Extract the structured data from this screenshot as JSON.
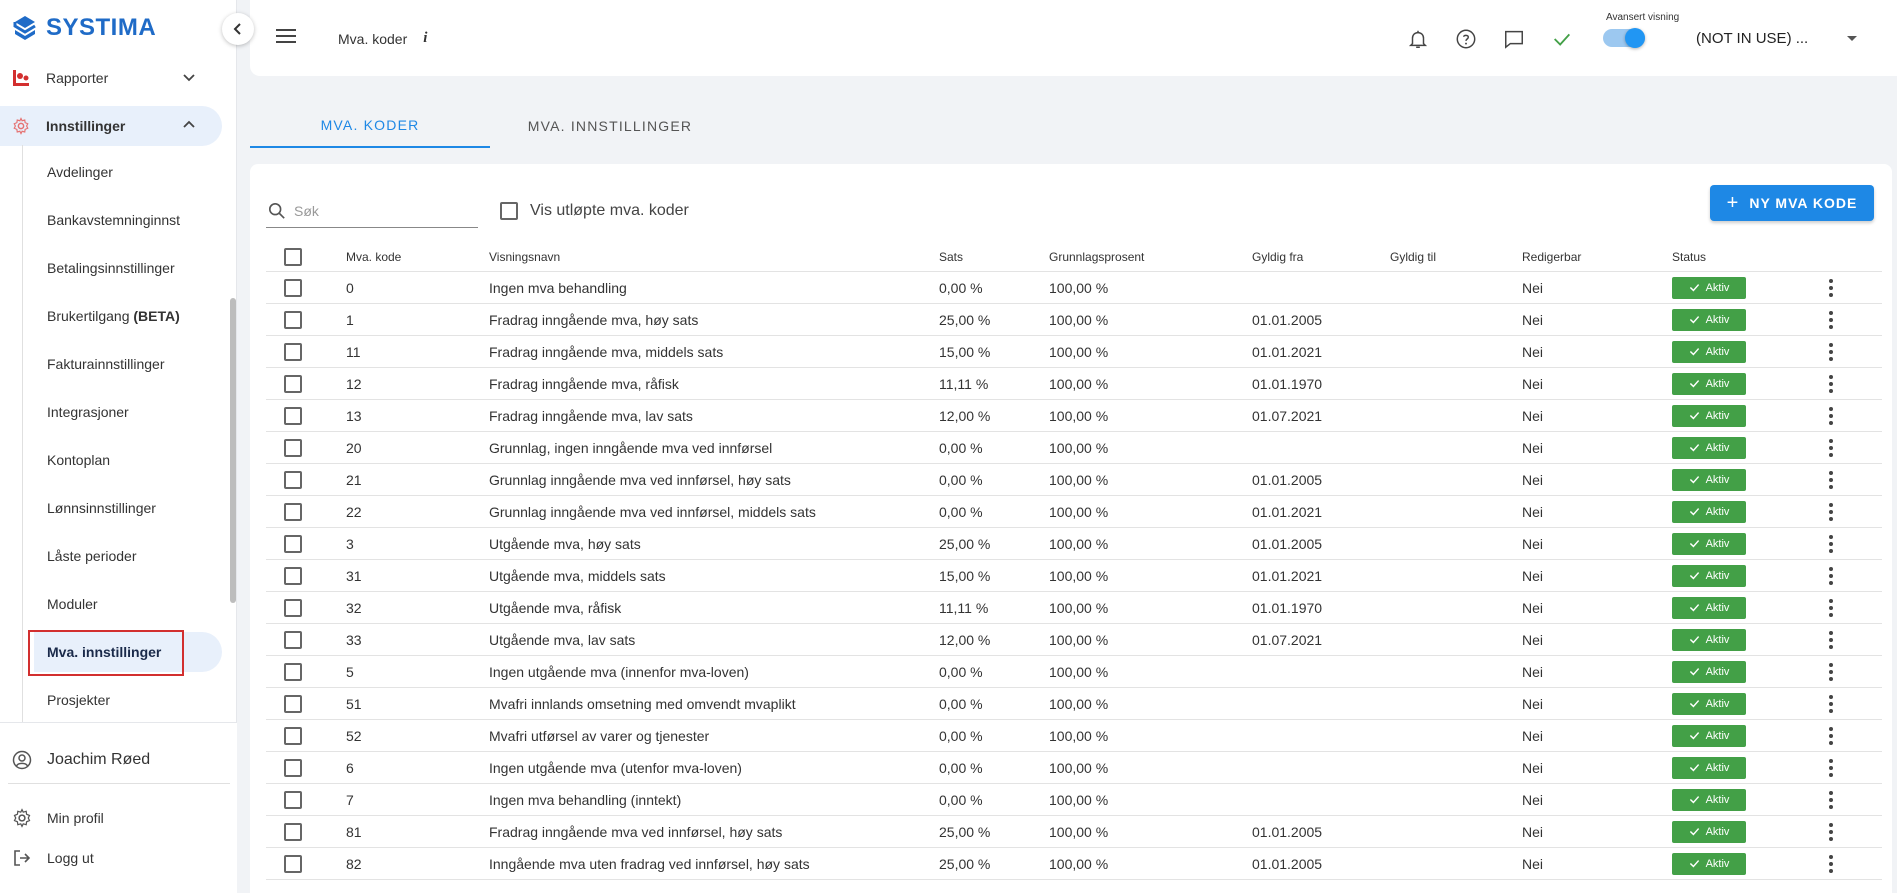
{
  "app": {
    "logo_text": "SYSTIMA",
    "brand_color": "#1f6bc7",
    "accent_color": "#1e88e5",
    "status_color": "#43a047"
  },
  "sidebar": {
    "sections": [
      {
        "label": "Rapporter",
        "icon": "reports-icon",
        "expanded": false
      },
      {
        "label": "Innstillinger",
        "icon": "gear-icon",
        "expanded": true
      }
    ],
    "sub_items": [
      {
        "label": "Avdelinger"
      },
      {
        "label": "Bankavstemninginnst"
      },
      {
        "label": "Betalingsinnstillinger"
      },
      {
        "label": "Brukertilgang",
        "suffix": "(BETA)"
      },
      {
        "label": "Fakturainnstillinger"
      },
      {
        "label": "Integrasjoner"
      },
      {
        "label": "Kontoplan"
      },
      {
        "label": "Lønnsinnstillinger"
      },
      {
        "label": "Låste perioder"
      },
      {
        "label": "Moduler"
      },
      {
        "label": "Mva. innstillinger",
        "selected": true
      },
      {
        "label": "Prosjekter"
      }
    ],
    "user_name": "Joachim Røed",
    "profile_label": "Min profil",
    "logout_label": "Logg ut"
  },
  "header": {
    "title": "Mva. koder",
    "info_glyph": "i",
    "advanced_label": "Avansert visning",
    "advanced_on": true,
    "company": "(NOT IN USE) ..."
  },
  "tabs": [
    {
      "label": "MVA. KODER",
      "active": true
    },
    {
      "label": "MVA. INNSTILLINGER",
      "active": false
    }
  ],
  "toolbar": {
    "search_placeholder": "Søk",
    "show_expired_label": "Vis utløpte mva. koder",
    "new_button_label": "NY MVA KODE",
    "new_button_glyph": "+"
  },
  "table": {
    "headers": {
      "code": "Mva. kode",
      "name": "Visningsnavn",
      "rate": "Sats",
      "base": "Grunnlagsprosent",
      "from": "Gyldig fra",
      "to": "Gyldig til",
      "editable": "Redigerbar",
      "status": "Status"
    },
    "rows": [
      {
        "code": "0",
        "name": "Ingen mva behandling",
        "rate": "0,00 %",
        "base": "100,00 %",
        "from": "",
        "to": "",
        "editable": "Nei",
        "status": "Aktiv"
      },
      {
        "code": "1",
        "name": "Fradrag inngående mva, høy sats",
        "rate": "25,00 %",
        "base": "100,00 %",
        "from": "01.01.2005",
        "to": "",
        "editable": "Nei",
        "status": "Aktiv"
      },
      {
        "code": "11",
        "name": "Fradrag inngående mva, middels sats",
        "rate": "15,00 %",
        "base": "100,00 %",
        "from": "01.01.2021",
        "to": "",
        "editable": "Nei",
        "status": "Aktiv"
      },
      {
        "code": "12",
        "name": "Fradrag inngående mva, råfisk",
        "rate": "11,11 %",
        "base": "100,00 %",
        "from": "01.01.1970",
        "to": "",
        "editable": "Nei",
        "status": "Aktiv"
      },
      {
        "code": "13",
        "name": "Fradrag inngående mva, lav sats",
        "rate": "12,00 %",
        "base": "100,00 %",
        "from": "01.07.2021",
        "to": "",
        "editable": "Nei",
        "status": "Aktiv"
      },
      {
        "code": "20",
        "name": "Grunnlag, ingen inngående mva ved innførsel",
        "rate": "0,00 %",
        "base": "100,00 %",
        "from": "",
        "to": "",
        "editable": "Nei",
        "status": "Aktiv"
      },
      {
        "code": "21",
        "name": "Grunnlag inngående mva ved innførsel, høy sats",
        "rate": "0,00 %",
        "base": "100,00 %",
        "from": "01.01.2005",
        "to": "",
        "editable": "Nei",
        "status": "Aktiv"
      },
      {
        "code": "22",
        "name": "Grunnlag inngående mva ved innførsel, middels sats",
        "rate": "0,00 %",
        "base": "100,00 %",
        "from": "01.01.2021",
        "to": "",
        "editable": "Nei",
        "status": "Aktiv"
      },
      {
        "code": "3",
        "name": "Utgående mva, høy sats",
        "rate": "25,00 %",
        "base": "100,00 %",
        "from": "01.01.2005",
        "to": "",
        "editable": "Nei",
        "status": "Aktiv"
      },
      {
        "code": "31",
        "name": "Utgående mva, middels sats",
        "rate": "15,00 %",
        "base": "100,00 %",
        "from": "01.01.2021",
        "to": "",
        "editable": "Nei",
        "status": "Aktiv"
      },
      {
        "code": "32",
        "name": "Utgående mva, råfisk",
        "rate": "11,11 %",
        "base": "100,00 %",
        "from": "01.01.1970",
        "to": "",
        "editable": "Nei",
        "status": "Aktiv"
      },
      {
        "code": "33",
        "name": "Utgående mva, lav sats",
        "rate": "12,00 %",
        "base": "100,00 %",
        "from": "01.07.2021",
        "to": "",
        "editable": "Nei",
        "status": "Aktiv"
      },
      {
        "code": "5",
        "name": "Ingen utgående mva (innenfor mva-loven)",
        "rate": "0,00 %",
        "base": "100,00 %",
        "from": "",
        "to": "",
        "editable": "Nei",
        "status": "Aktiv"
      },
      {
        "code": "51",
        "name": "Mvafri innlands omsetning med omvendt mvaplikt",
        "rate": "0,00 %",
        "base": "100,00 %",
        "from": "",
        "to": "",
        "editable": "Nei",
        "status": "Aktiv"
      },
      {
        "code": "52",
        "name": "Mvafri utførsel av varer og tjenester",
        "rate": "0,00 %",
        "base": "100,00 %",
        "from": "",
        "to": "",
        "editable": "Nei",
        "status": "Aktiv"
      },
      {
        "code": "6",
        "name": "Ingen utgående mva (utenfor mva-loven)",
        "rate": "0,00 %",
        "base": "100,00 %",
        "from": "",
        "to": "",
        "editable": "Nei",
        "status": "Aktiv"
      },
      {
        "code": "7",
        "name": "Ingen mva behandling (inntekt)",
        "rate": "0,00 %",
        "base": "100,00 %",
        "from": "",
        "to": "",
        "editable": "Nei",
        "status": "Aktiv"
      },
      {
        "code": "81",
        "name": "Fradrag inngående mva ved innførsel, høy sats",
        "rate": "25,00 %",
        "base": "100,00 %",
        "from": "01.01.2005",
        "to": "",
        "editable": "Nei",
        "status": "Aktiv"
      },
      {
        "code": "82",
        "name": "Inngående mva uten fradrag ved innførsel, høy sats",
        "rate": "25,00 %",
        "base": "100,00 %",
        "from": "01.01.2005",
        "to": "",
        "editable": "Nei",
        "status": "Aktiv"
      }
    ]
  }
}
